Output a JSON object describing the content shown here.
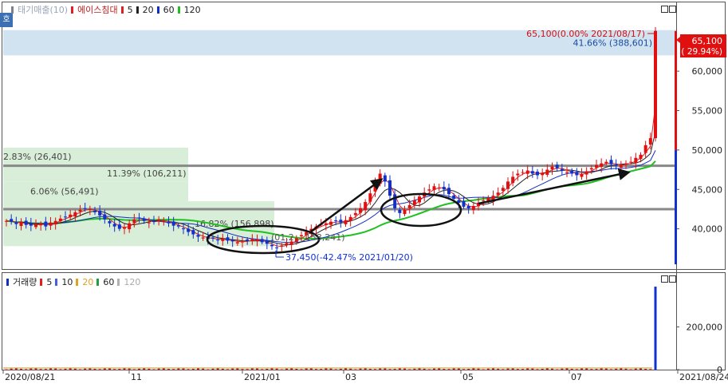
{
  "price_legend": {
    "title": "태기매출(10)",
    "name": "에이스침대",
    "ma": [
      {
        "label": "5",
        "color": "#e02020"
      },
      {
        "label": "20",
        "color": "#222222"
      },
      {
        "label": "60",
        "color": "#1030c0"
      },
      {
        "label": "120",
        "color": "#20c020"
      }
    ]
  },
  "volume_legend": {
    "title": "거래량",
    "ma": [
      {
        "label": "5",
        "color": "#e02020"
      },
      {
        "label": "10",
        "color": "#4060e0"
      },
      {
        "label": "20",
        "color": "#e0a020"
      },
      {
        "label": "60",
        "color": "#20a040"
      },
      {
        "label": "120",
        "color": "#b0b0b0"
      }
    ]
  },
  "side_tag": "호",
  "chart_data": [
    {
      "type": "candlestick",
      "title": "",
      "ylim": [
        35000,
        67000
      ],
      "y_ticks": [
        40000,
        45000,
        50000,
        55000,
        60000
      ],
      "y_tick_labels": [
        "40,000",
        "45,000",
        "50,000",
        "55,000",
        "60,000"
      ],
      "x_tick_labels": [
        "2020/08/21",
        "11",
        "2021/01",
        "03",
        "05",
        "07",
        "2021/08/24"
      ],
      "current_price": {
        "label": "65,100",
        "change": "( 29.94%)"
      },
      "high_annotation": "65,100(0.00% 2021/08/17)",
      "low_annotation": "37,450(-42.47% 2021/01/20)",
      "horizontal_lines": [
        48000,
        42500
      ],
      "volume_profile": [
        {
          "label": "41.66% (388,601)",
          "low": 62000,
          "high": 65200
        },
        {
          "label": "2.83% (26,401)",
          "low": 48100,
          "high": 50300
        },
        {
          "label": "11.39% (106,211)",
          "low": 46000,
          "high": 48100
        },
        {
          "label": "6.06% (56,491)",
          "low": 43500,
          "high": 46000
        },
        {
          "label": "16.82% (156,898)",
          "low": 37800,
          "high": 43500
        }
      ],
      "hidden_label": "(01.2... 158,241)",
      "close_series": [
        41000,
        40900,
        40600,
        40900,
        40500,
        40400,
        40600,
        40700,
        40300,
        40800,
        41000,
        41300,
        41500,
        41800,
        42100,
        42400,
        42600,
        42500,
        42100,
        41700,
        41200,
        40700,
        40300,
        40000,
        40200,
        40700,
        41200,
        41400,
        41000,
        40800,
        40900,
        41200,
        41000,
        40700,
        40400,
        40300,
        40000,
        39600,
        39300,
        39000,
        38900,
        38700,
        38800,
        38600,
        38700,
        38500,
        38400,
        38300,
        38400,
        38500,
        38700,
        38600,
        38300,
        38100,
        37800,
        37600,
        37900,
        38200,
        38400,
        38800,
        39200,
        39600,
        40000,
        40300,
        40600,
        40700,
        40900,
        41000,
        40800,
        41100,
        41500,
        42000,
        42600,
        43400,
        44500,
        45800,
        47000,
        46000,
        44200,
        42600,
        42000,
        42400,
        43000,
        43600,
        44100,
        44600,
        45000,
        45400,
        45200,
        45000,
        44400,
        43800,
        43300,
        42800,
        42600,
        42900,
        43300,
        43600,
        43900,
        44200,
        44600,
        45200,
        46000,
        46600,
        47000,
        47200,
        47400,
        47000,
        46800,
        47100,
        47500,
        47900,
        47700,
        47400,
        47200,
        47000,
        46800,
        47000,
        47300,
        47700,
        48100,
        48300,
        48500,
        48200,
        48000,
        48100,
        48300,
        48500,
        49000,
        49400,
        50600,
        51500,
        65100
      ],
      "ma_series": [
        {
          "name": "5",
          "color": "#e02020"
        },
        {
          "name": "20",
          "color": "#222222"
        },
        {
          "name": "60",
          "color": "#1030c0"
        },
        {
          "name": "120",
          "color": "#20c020"
        }
      ],
      "grid": false
    },
    {
      "type": "bar",
      "title": "거래량",
      "ylim": [
        0,
        400000
      ],
      "y_ticks": [
        0,
        200000
      ],
      "y_tick_labels": [
        "0",
        "200,000"
      ],
      "last_volume": 388601
    }
  ]
}
